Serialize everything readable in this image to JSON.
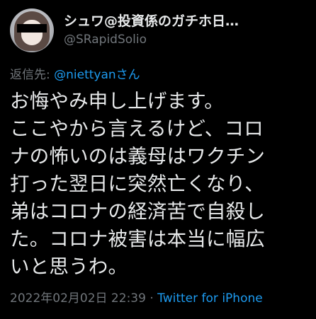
{
  "header": {
    "display_name": "シュワ@投資係のガチホ日…",
    "handle": "@SRapidSolio"
  },
  "reply": {
    "prefix": "返信先: ",
    "mention": "@niettyanさん"
  },
  "tweet": {
    "lines": [
      "お悔やみ申し上げます。",
      "ここやから言えるけど、コロ",
      "ナの怖いのは義母はワクチン",
      "打った翌日に突然亡くなり、",
      "弟はコロナの経済苦で自殺し",
      "た。コロナ被害は本当に幅広",
      "いと思うわ。"
    ]
  },
  "meta": {
    "timestamp": "2022年02月02日 22:39",
    "separator": " · ",
    "source": "Twitter for iPhone"
  },
  "colors": {
    "background": "#000000",
    "text": "#e7e9ea",
    "secondary": "#71767b",
    "link": "#1d9bf0"
  }
}
